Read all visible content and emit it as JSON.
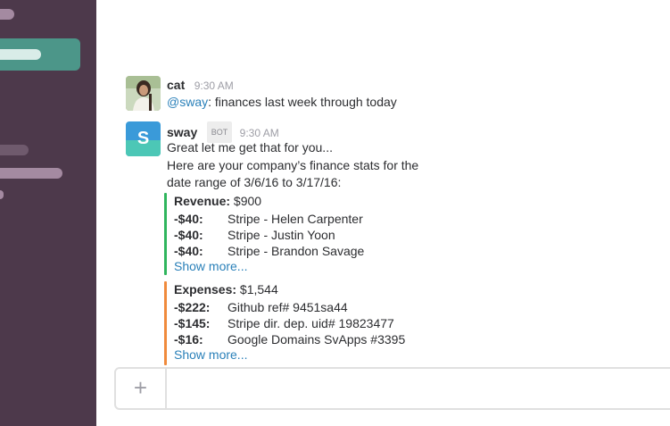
{
  "colors": {
    "sidebar": "#4d394b",
    "active_item": "#4c9689",
    "mention": "#2a80b9",
    "revenue_bar": "#2fb55d",
    "expenses_bar": "#f08a3c"
  },
  "messages": [
    {
      "user": "cat",
      "time": "9:30 AM",
      "mention": "@sway",
      "text": ": finances last week through today"
    },
    {
      "user": "sway",
      "badge": "BOT",
      "time": "9:30 AM",
      "avatar_letter": "S",
      "lines": [
        "Great let me get that for you...",
        "Here are your company’s finance stats for the",
        "date range of 3/6/16 to 3/17/16:"
      ]
    }
  ],
  "revenue": {
    "label": "Revenue:",
    "total": " $900",
    "items": [
      {
        "amount": "-$40:",
        "desc": "Stripe - Helen Carpenter"
      },
      {
        "amount": "-$40:",
        "desc": "Stripe - Justin Yoon"
      },
      {
        "amount": "-$40:",
        "desc": "Stripe - Brandon Savage"
      }
    ],
    "show_more": "Show more..."
  },
  "expenses": {
    "label": "Expenses:",
    "total": " $1,544",
    "items": [
      {
        "amount": "-$222:",
        "desc": "Github ref# 9451sa44"
      },
      {
        "amount": "-$145:",
        "desc": "Stripe dir. dep. uid# 19823477"
      },
      {
        "amount": "-$16:",
        "desc": "Google Domains SvApps #3395"
      }
    ],
    "show_more": "Show more..."
  },
  "composer": {
    "plus_icon": "+",
    "plus_icon_name": "plus-icon"
  }
}
